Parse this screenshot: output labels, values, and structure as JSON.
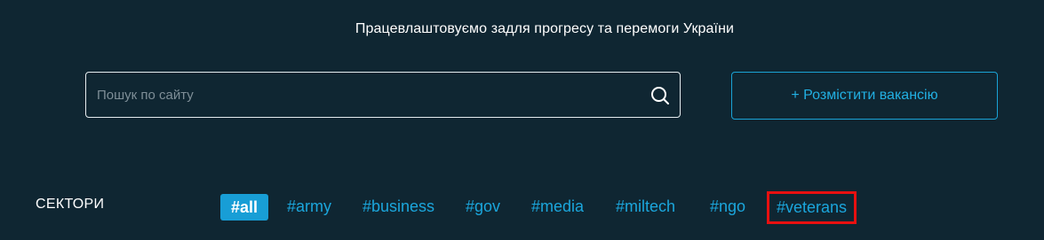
{
  "header": {
    "tagline": "Працевлаштовуємо задля прогресу та перемоги України"
  },
  "search": {
    "placeholder": "Пошук по сайту",
    "value": "",
    "icon": "search-icon"
  },
  "actions": {
    "post_job_label": "+ Розмістити вакансію"
  },
  "sectors": {
    "label": "СЕКТОРИ",
    "tags": [
      {
        "label": "#all",
        "active": true
      },
      {
        "label": "#army",
        "active": false
      },
      {
        "label": "#business",
        "active": false
      },
      {
        "label": "#gov",
        "active": false
      },
      {
        "label": "#media",
        "active": false
      },
      {
        "label": "#miltech",
        "active": false
      },
      {
        "label": "#ngo",
        "active": false
      },
      {
        "label": "#veterans",
        "active": false,
        "highlighted": true
      }
    ]
  },
  "colors": {
    "background": "#0f2632",
    "accent": "#1ba6dc",
    "highlight_border": "#e81010"
  }
}
